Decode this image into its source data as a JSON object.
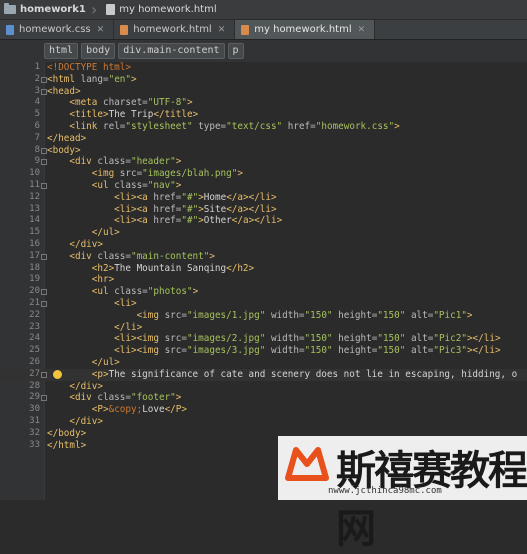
{
  "topbar": {
    "project": "homework1",
    "file": "my homework.html"
  },
  "tabs": [
    {
      "label": "homework.css",
      "kind": "css",
      "active": false
    },
    {
      "label": "homework.html",
      "kind": "html",
      "active": false
    },
    {
      "label": "my homework.html",
      "kind": "html",
      "active": true
    }
  ],
  "path": [
    "html",
    "body",
    "div.main-content",
    "p"
  ],
  "code_lines": [
    "<!DOCTYPE html>",
    "<html lang=\"en\">",
    "<head>",
    "    <meta charset=\"UTF-8\">",
    "    <title>The Trip</title>",
    "    <link rel=\"stylesheet\" type=\"text/css\" href=\"homework.css\">",
    "</head>",
    "<body>",
    "    <div class=\"header\">",
    "        <img src=\"images/blah.png\">",
    "        <ul class=\"nav\">",
    "            <li><a href=\"#\">Home</a></li>",
    "            <li><a href=\"#\">Site</a></li>",
    "            <li><a href=\"#\">Other</a></li>",
    "        </ul>",
    "    </div>",
    "    <div class=\"main-content\">",
    "        <h2>The Mountain Sanqing</h2>",
    "        <hr>",
    "        <ul class=\"photos\">",
    "            <li>",
    "                <img src=\"images/1.jpg\" width=\"150\" height=\"150\" alt=\"Pic1\">",
    "            </li>",
    "            <li><img src=\"images/2.jpg\" width=\"150\" height=\"150\" alt=\"Pic2\"></li>",
    "            <li><img src=\"images/3.jpg\" width=\"150\" height=\"150\" alt=\"Pic3\"></li>",
    "        </ul>",
    "        <p>The significance of cate and scenery does not lie in escaping, hidding, o",
    "    </div>",
    "    <div class=\"footer\">",
    "        <P>&copy;Love</P>",
    "    </div>",
    "</body>",
    "</html>"
  ],
  "watermark": {
    "text": "斯禧赛教程网",
    "url": "nwww.jcthinca98mc.com"
  }
}
